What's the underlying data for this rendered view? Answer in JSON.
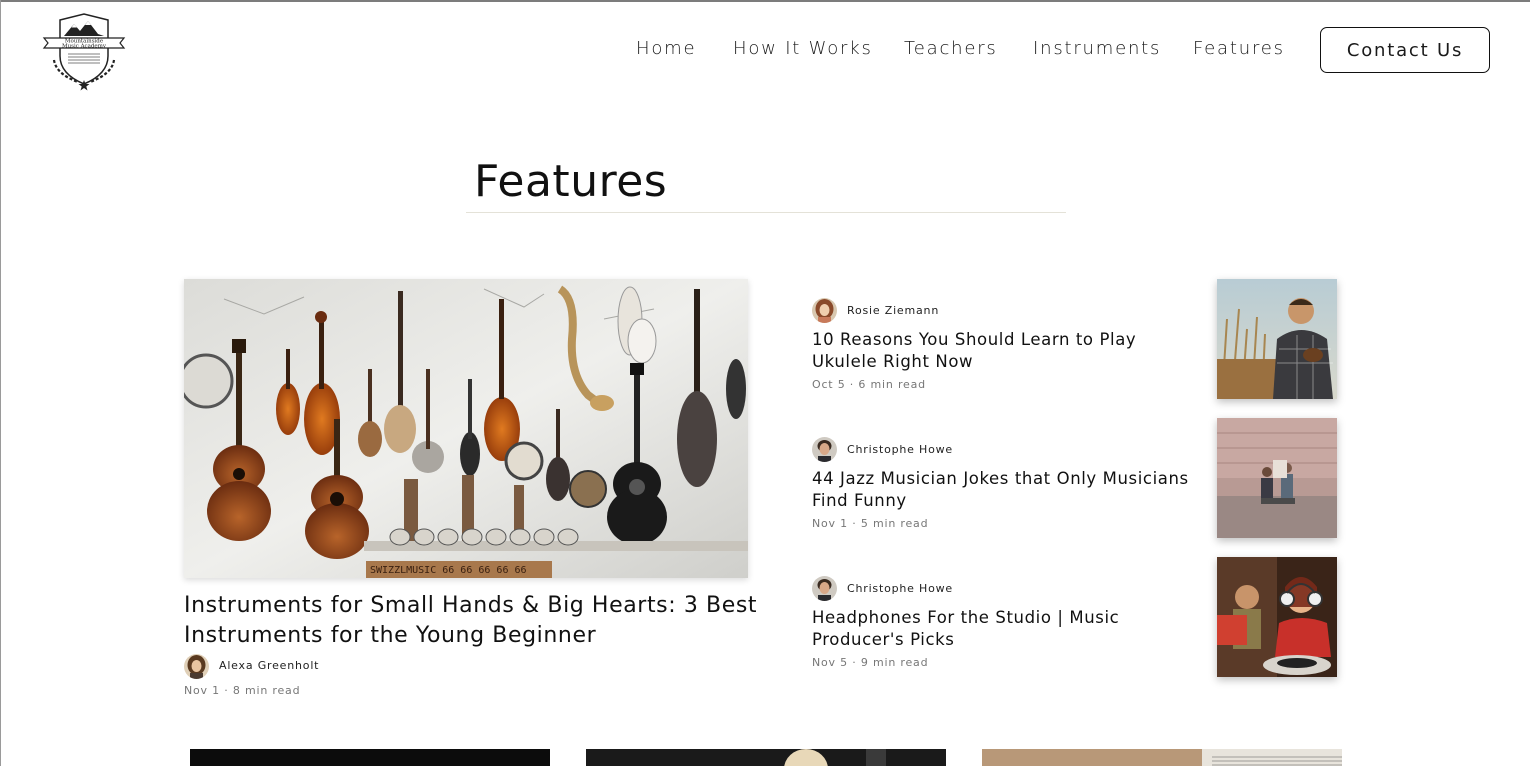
{
  "brand": {
    "logo_icon": "mountain-crest-logo-icon",
    "logo_text_line1": "Mountainside",
    "logo_text_line2": "Music Academy"
  },
  "nav": {
    "items": [
      {
        "label": "Home"
      },
      {
        "label": "How It Works"
      },
      {
        "label": "Teachers"
      },
      {
        "label": "Instruments"
      },
      {
        "label": "Features"
      }
    ],
    "contact_label": "Contact Us"
  },
  "page": {
    "title": "Features"
  },
  "featured": {
    "title": "Instruments for Small Hands & Big Hearts: 3 Best Instruments for the Young Beginner",
    "author": "Alexa Greenholt",
    "meta": "Nov 1 · 8 min read",
    "image_icon": "instrument-wall-photo",
    "sign_text": "SWIZZLMUSIC 66 66 66 66 66"
  },
  "posts": [
    {
      "author": "Rosie Ziemann",
      "title": "10 Reasons You Should Learn to Play Ukulele Right Now",
      "meta": "Oct 5 · 6 min read",
      "image_icon": "ukulele-player-photo"
    },
    {
      "author": "Christophe Howe",
      "title": "44 Jazz Musician Jokes that Only Musicians Find Funny",
      "meta": "Nov 1 · 5 min read",
      "image_icon": "street-musicians-photo"
    },
    {
      "author": "Christophe Howe",
      "title": "Headphones For the Studio | Music Producer's Picks",
      "meta": "Nov 5 · 9 min read",
      "image_icon": "retro-headphones-photo"
    }
  ],
  "colors": {
    "text": "#111111",
    "meta": "#777777",
    "rule": "#e4e2d8"
  }
}
